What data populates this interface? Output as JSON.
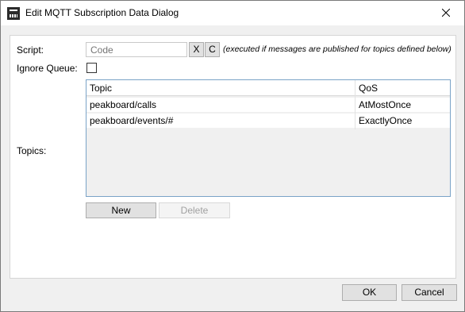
{
  "window": {
    "title": "Edit MQTT Subscription Data Dialog"
  },
  "icons": {
    "app": "peakboard-logo-icon",
    "close": "close-icon"
  },
  "form": {
    "script_label": "Script:",
    "script_placeholder": "Code",
    "clear_button": "X",
    "code_button": "C",
    "script_hint": "(executed if messages are published for topics defined below)",
    "ignore_queue_label": "Ignore Queue:",
    "ignore_queue_checked": false,
    "topics_label": "Topics:"
  },
  "topics_table": {
    "columns": [
      "Topic",
      "QoS"
    ],
    "rows": [
      {
        "topic": "peakboard/calls",
        "qos": "AtMostOnce"
      },
      {
        "topic": "peakboard/events/#",
        "qos": "ExactlyOnce"
      }
    ]
  },
  "topic_actions": {
    "new_label": "New",
    "delete_label": "Delete"
  },
  "footer": {
    "ok_label": "OK",
    "cancel_label": "Cancel"
  },
  "colors": {
    "grid_border": "#7aa3c7",
    "button_face": "#e1e1e1"
  }
}
